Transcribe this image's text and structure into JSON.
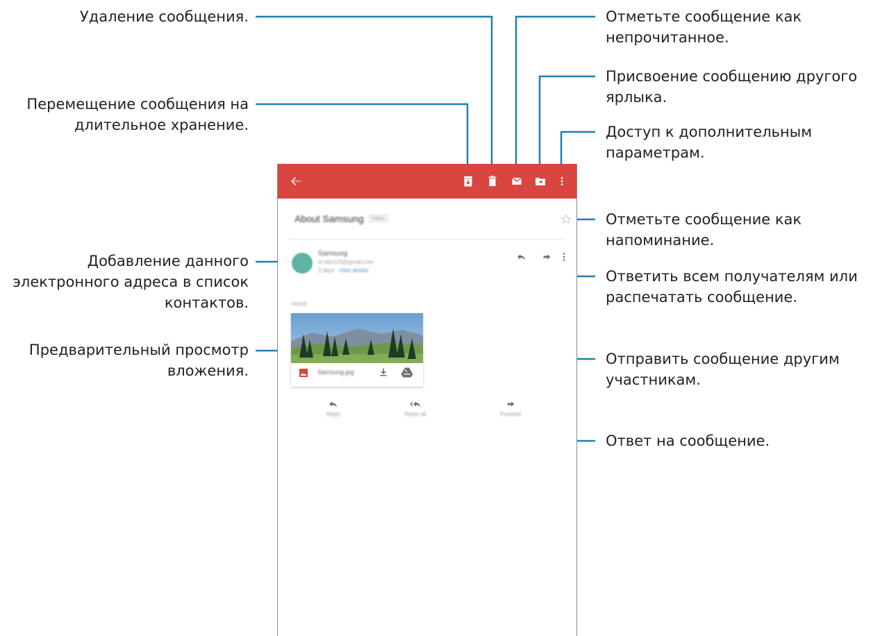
{
  "callouts": {
    "delete": "Удаление сообщения.",
    "archive_line1": "Перемещение сообщения на",
    "archive_line2": "длительное хранение.",
    "add_contact_line1": "Добавление данного",
    "add_contact_line2": "электронного адреса в список",
    "add_contact_line3": "контактов.",
    "preview_line1": "Предварительный просмотр",
    "preview_line2": "вложения.",
    "unread_line1": "Отметьте сообщение как",
    "unread_line2": "непрочитанное.",
    "label_line1": "Присвоение сообщению другого",
    "label_line2": "ярлыка.",
    "more_line1": "Доступ к дополнительным",
    "more_line2": "параметрам.",
    "star_line1": "Отметьте сообщение как",
    "star_line2": "напоминание.",
    "reply_all_line1": "Ответить всем получателям или",
    "reply_all_line2": "распечатать сообщение.",
    "forward_line1": "Отправить сообщение другим",
    "forward_line2": "участникам.",
    "reply": "Ответ на сообщение."
  },
  "email": {
    "subject": "About Samsung",
    "subject_tag": "Inbox",
    "sender_name": "Samsung",
    "sender_email": "to abc123@gmail.com",
    "sender_meta": "2 days",
    "sender_link": "View details",
    "attachment_heading": "IMAGE",
    "attachment_name": "Samsung.jpg",
    "bottom_reply": "Reply",
    "bottom_reply_all": "Reply all",
    "bottom_forward": "Forward"
  },
  "colors": {
    "app_bar": "#d9453f",
    "leader_line": "#1f7fae",
    "avatar": "#5fb3a2",
    "link": "#4a90d9"
  },
  "icons": {
    "back": "arrow-left-icon",
    "archive": "archive-icon",
    "delete": "trash-icon",
    "unread": "envelope-icon",
    "move": "folder-move-icon",
    "more": "more-vertical-icon",
    "star": "star-outline-icon",
    "reply": "reply-icon",
    "forward": "forward-icon"
  }
}
